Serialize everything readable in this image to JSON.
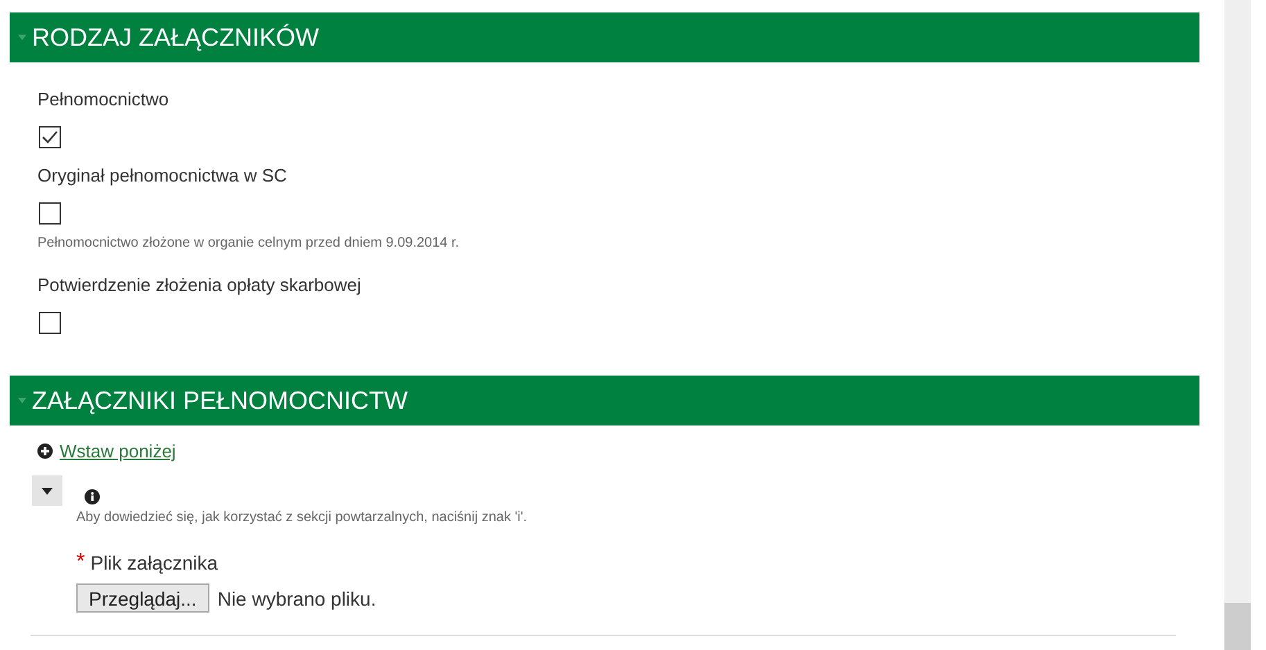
{
  "sections": [
    {
      "title": "RODZAJ ZAŁĄCZNIKÓW",
      "expanded": true,
      "kind": "checkboxes",
      "fields": [
        {
          "label": "Pełnomocnictwo",
          "checked": true
        },
        {
          "label": "Oryginał pełnomocnictwa w SC",
          "checked": false,
          "hint": "Pełnomocnictwo złożone w organie celnym przed dniem 9.09.2014 r."
        },
        {
          "label": "Potwierdzenie złożenia opłaty skarbowej",
          "checked": false
        }
      ]
    },
    {
      "title": "ZAŁĄCZNIKI PEŁNOMOCNICTW",
      "expanded": true,
      "kind": "repeat",
      "insert_link": "Wstaw poniżej",
      "repeat_hint": "Aby dowiedzieć się, jak korzystać z sekcji powtarzalnych, naciśnij znak 'i'.",
      "required_mark": "*",
      "file_label": "Plik załącznika",
      "browse_button": "Przeglądaj...",
      "file_status": "Nie wybrano pliku."
    }
  ]
}
